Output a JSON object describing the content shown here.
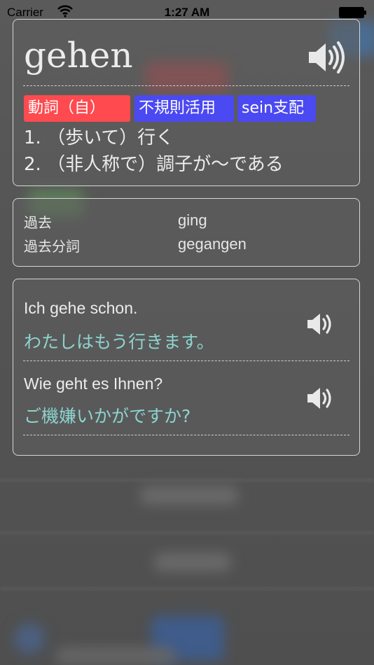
{
  "status_bar": {
    "carrier": "Carrier",
    "time": "1:27 AM"
  },
  "word_card": {
    "headword": "gehen",
    "tags": [
      {
        "label": "動詞（自）",
        "color": "#ff4a4f"
      },
      {
        "label": "不規則活用",
        "color": "#4b49f2"
      },
      {
        "label": "sein支配",
        "color": "#4b49f2"
      }
    ],
    "meanings": [
      "1. （歩いて）行く",
      "2. （非人称で）調子が～である"
    ],
    "speaker_icon": "speaker-icon"
  },
  "forms": [
    {
      "label": "過去",
      "value": "ging"
    },
    {
      "label": "過去分詞",
      "value": "gegangen"
    }
  ],
  "examples": [
    {
      "german": "Ich gehe schon.",
      "japanese": "わたしはもう行きます。"
    },
    {
      "german": "Wie geht es Ihnen?",
      "japanese": "ご機嫌いかがですか?"
    }
  ],
  "colors": {
    "card_border": "#d6d6d6",
    "text": "#ececec",
    "translation": "#8cd4cf"
  }
}
